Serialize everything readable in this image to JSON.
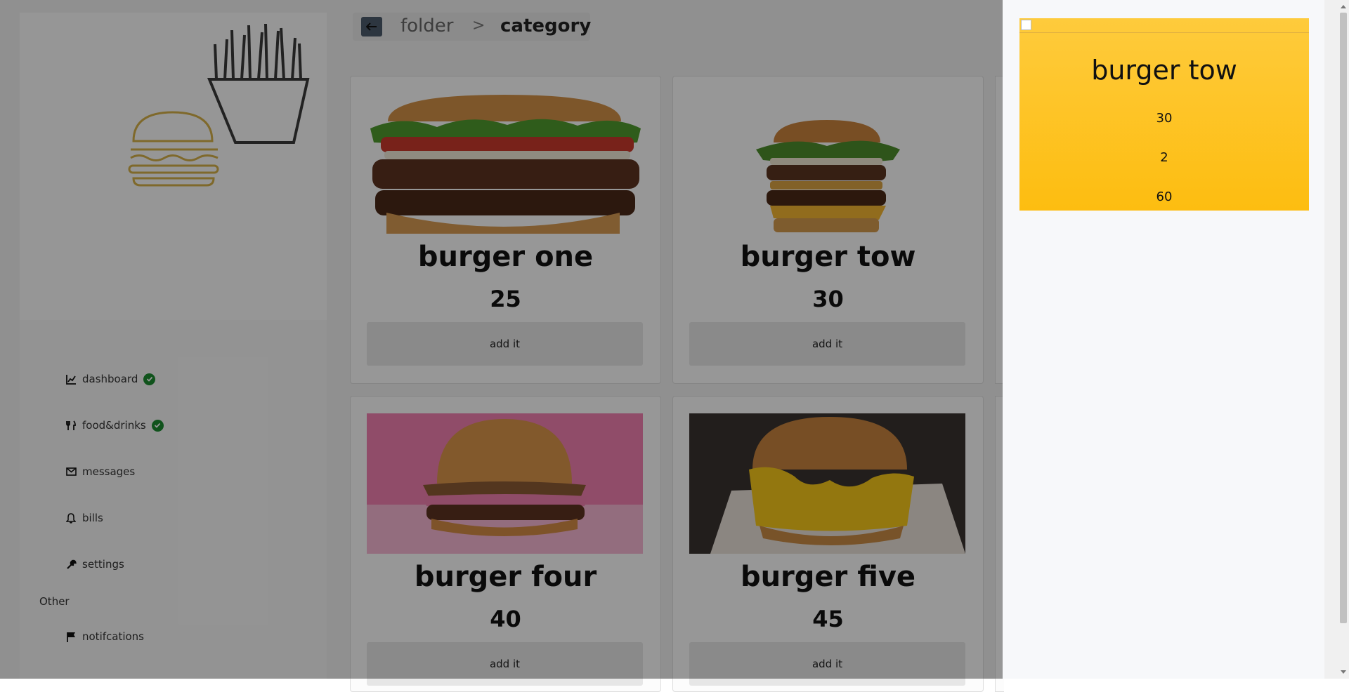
{
  "breadcrumb": {
    "folder": "folder",
    "separator": ">",
    "category": "category"
  },
  "sidebar": {
    "items": [
      {
        "label": "dashboard",
        "icon": "chart-line-icon",
        "checked": true
      },
      {
        "label": "food&drinks",
        "icon": "utensils-icon",
        "checked": true
      },
      {
        "label": "messages",
        "icon": "envelope-icon",
        "checked": false
      },
      {
        "label": "bills",
        "icon": "bell-icon",
        "checked": false
      },
      {
        "label": "settings",
        "icon": "wrench-icon",
        "checked": false
      }
    ],
    "other_label": "Other",
    "other_items": [
      {
        "label": "notifcations",
        "icon": "flag-icon"
      }
    ]
  },
  "products": [
    {
      "name": "burger one",
      "price": "25",
      "button": "add it"
    },
    {
      "name": "burger tow",
      "price": "30",
      "button": "add it"
    },
    {
      "name": "burger four",
      "price": "40",
      "button": "add it"
    },
    {
      "name": "burger five",
      "price": "45",
      "button": "add it"
    }
  ],
  "panel": {
    "name": "burger tow",
    "price": "30",
    "quantity": "2",
    "total": "60"
  },
  "colors": {
    "accent": "#fdbd10",
    "check": "#1b8a2f"
  }
}
